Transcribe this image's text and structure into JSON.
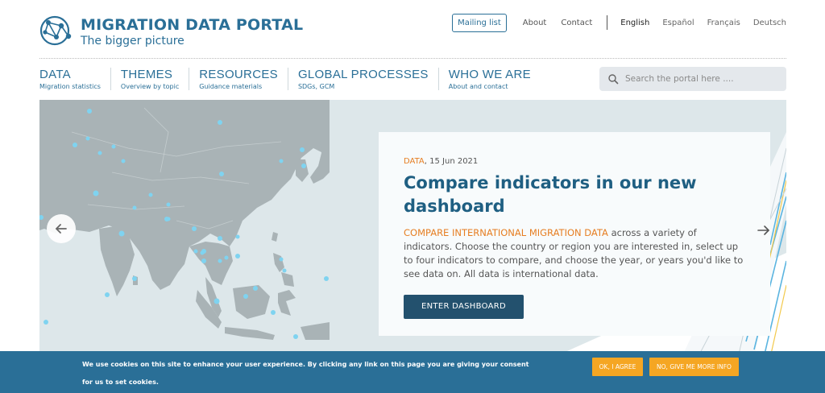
{
  "brand": {
    "title": "MIGRATION DATA PORTAL",
    "subtitle": "The bigger picture",
    "logo_icon": "network-globe-icon",
    "color": "#2a6f97"
  },
  "top_nav": {
    "mailing_list": "Mailing list",
    "links": [
      "About",
      "Contact"
    ],
    "languages": [
      "English",
      "Español",
      "Français",
      "Deutsch"
    ],
    "active_language": "English"
  },
  "main_nav": [
    {
      "title": "DATA",
      "sub": "Migration statistics"
    },
    {
      "title": "THEMES",
      "sub": "Overview by topic"
    },
    {
      "title": "RESOURCES",
      "sub": "Guidance materials"
    },
    {
      "title": "GLOBAL PROCESSES",
      "sub": "SDGs, GCM"
    },
    {
      "title": "WHO WE ARE",
      "sub": "About and contact"
    }
  ],
  "search": {
    "placeholder": "Search the portal here ....",
    "value": "",
    "icon": "search-icon"
  },
  "hero": {
    "category": "DATA",
    "date": ", 15 Jun 2021",
    "title": "Compare indicators in our new dashboard",
    "highlight": "COMPARE INTERNATIONAL MIGRATION DATA",
    "body": " across a variety of indicators. Choose the country or region you are interested in, select up to four indicators to compare, and choose the year, or years you'd like to see data on. All data is international data.",
    "button": "ENTER DASHBOARD",
    "prev_icon": "arrow-left-icon",
    "next_icon": "arrow-right-icon",
    "accent_color": "#e67e22",
    "button_color": "#23516e"
  },
  "cookie": {
    "text": "We use cookies on this site to enhance your user experience. By clicking any link on this page you are giving your consent for us to set cookies.",
    "agree": "OK, I AGREE",
    "info": "NO, GIVE ME MORE INFO",
    "banner_color": "#2a6f97",
    "button_color": "#f5a623"
  }
}
